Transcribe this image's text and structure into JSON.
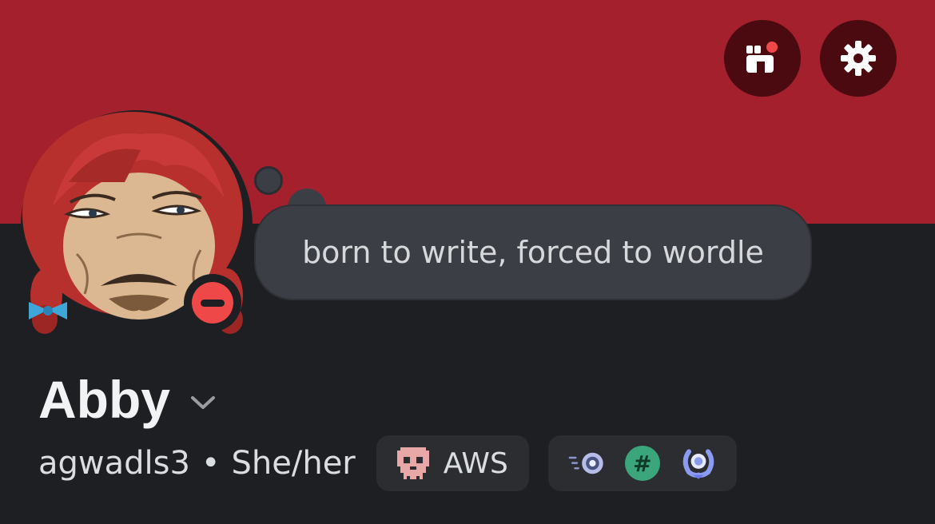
{
  "profile": {
    "display_name": "Abby",
    "username": "agwadls3",
    "separator": "•",
    "pronouns": "She/her",
    "custom_status": "born to write, forced to wordle",
    "online_status": "do-not-disturb",
    "server_tag": {
      "label": "AWS",
      "icon": "pixel-skull-icon"
    },
    "badges": [
      {
        "icon": "nitro-boost-icon"
      },
      {
        "icon": "hashtag-badge-icon",
        "glyph": "#"
      },
      {
        "icon": "laurel-badge-icon"
      }
    ]
  },
  "header": {
    "buttons": [
      {
        "icon": "shop-icon"
      },
      {
        "icon": "gear-icon"
      }
    ]
  },
  "colors": {
    "banner": "#a3202c",
    "background": "#1e1f22",
    "bubble": "#3c3e45",
    "dnd_status": "#ef4848",
    "hashtag_badge": "#3ba57c"
  }
}
